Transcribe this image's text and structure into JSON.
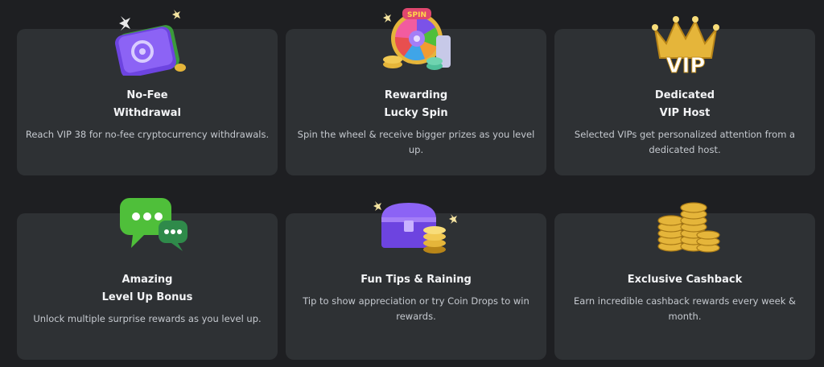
{
  "cards": [
    {
      "title1": "No-Fee",
      "title2": "Withdrawal",
      "description": "Reach VIP 38 for no-fee cryptocurrency withdrawals."
    },
    {
      "title1": "Rewarding",
      "title2": "Lucky Spin",
      "description": "Spin the wheel & receive bigger prizes as you level up.",
      "icon_text": "SPIN"
    },
    {
      "title1": "Dedicated",
      "title2": "VIP Host",
      "description": "Selected VIPs get personalized attention from a dedicated host.",
      "icon_text": "VIP"
    },
    {
      "title1": "Amazing",
      "title2": "Level Up Bonus",
      "description": "Unlock multiple surprise rewards as you level up."
    },
    {
      "title1": "Fun Tips & Raining",
      "description": "Tip to show appreciation or try Coin Drops to win rewards."
    },
    {
      "title1": "Exclusive Cashback",
      "description": "Earn incredible cashback rewards every week & month."
    }
  ],
  "icons": {
    "wallet": "wallet-icon",
    "spin": "lucky-spin-wheel-icon",
    "vip": "vip-crown-icon",
    "chat": "chat-bubbles-icon",
    "chest": "treasure-chest-icon",
    "coins": "coin-stacks-icon"
  },
  "colors": {
    "background": "#1e1f22",
    "card": "#2e3134",
    "title": "#f2f3f5",
    "description": "#c5c9cf",
    "purple": "#7b52e8",
    "gold": "#e5b53a",
    "green": "#4fbf3a"
  }
}
